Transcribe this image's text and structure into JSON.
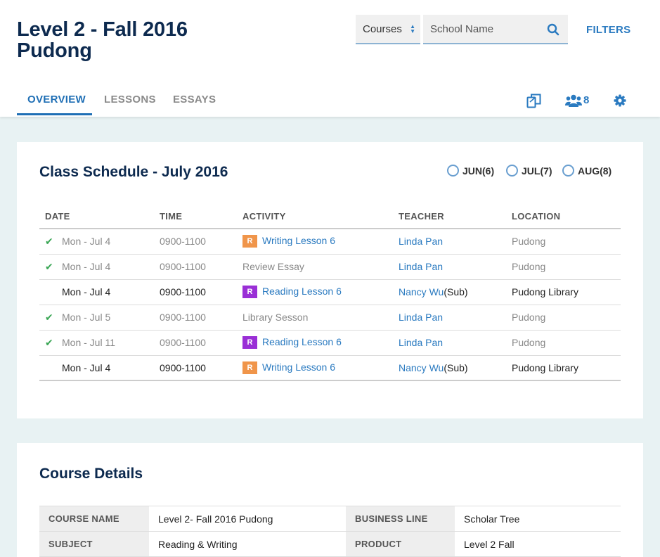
{
  "header": {
    "title_line1": "Level 2 - Fall 2016",
    "title_line2": "Pudong",
    "course_select": "Courses",
    "school_placeholder": "School Name",
    "filters_label": "FILTERS",
    "members_count": "8"
  },
  "tabs": [
    {
      "label": "OVERVIEW",
      "active": true
    },
    {
      "label": "LESSONS",
      "active": false
    },
    {
      "label": "ESSAYS",
      "active": false
    }
  ],
  "schedule": {
    "title": "Class Schedule - July 2016",
    "months": [
      "JUN(6)",
      "JUL(7)",
      "AUG(8)"
    ],
    "columns": [
      "DATE",
      "TIME",
      "ACTIVITY",
      "TEACHER",
      "LOCATION"
    ],
    "rows": [
      {
        "done": true,
        "date": "Mon - Jul 4",
        "time": "0900-1100",
        "badge": "R",
        "badge_color": "#f0954a",
        "activity": "Writing Lesson 6",
        "activity_link": true,
        "teacher": "Linda Pan",
        "teacher_suffix": "",
        "location": "Pudong"
      },
      {
        "done": true,
        "date": "Mon - Jul 4",
        "time": "0900-1100",
        "badge": "",
        "badge_color": "",
        "activity": "Review Essay",
        "activity_link": false,
        "teacher": "Linda Pan",
        "teacher_suffix": "",
        "location": "Pudong"
      },
      {
        "done": false,
        "date": "Mon - Jul 4",
        "time": "0900-1100",
        "badge": "R",
        "badge_color": "#9a2fd6",
        "activity": "Reading Lesson 6",
        "activity_link": true,
        "teacher": "Nancy Wu",
        "teacher_suffix": "(Sub)",
        "location": "Pudong Library"
      },
      {
        "done": true,
        "date": "Mon - Jul 5",
        "time": "0900-1100",
        "badge": "",
        "badge_color": "",
        "activity": "Library Sesson",
        "activity_link": false,
        "teacher": "Linda Pan",
        "teacher_suffix": "",
        "location": "Pudong"
      },
      {
        "done": true,
        "date": "Mon - Jul 11",
        "time": "0900-1100",
        "badge": "R",
        "badge_color": "#9a2fd6",
        "activity": "Reading Lesson 6",
        "activity_link": true,
        "teacher": "Linda Pan",
        "teacher_suffix": "",
        "location": "Pudong"
      },
      {
        "done": false,
        "date": "Mon - Jul 4",
        "time": "0900-1100",
        "badge": "R",
        "badge_color": "#f0954a",
        "activity": "Writing Lesson 6",
        "activity_link": true,
        "teacher": "Nancy Wu",
        "teacher_suffix": "(Sub)",
        "location": "Pudong Library"
      }
    ]
  },
  "details": {
    "title": "Course Details",
    "rows": [
      {
        "k1": "COURSE NAME",
        "v1": "Level 2- Fall 2016 Pudong",
        "k2": "BUSINESS LINE",
        "v2": "Scholar Tree"
      },
      {
        "k1": "SUBJECT",
        "v1": "Reading & Writing",
        "k2": "PRODUCT",
        "v2": "Level 2 Fall"
      }
    ]
  }
}
